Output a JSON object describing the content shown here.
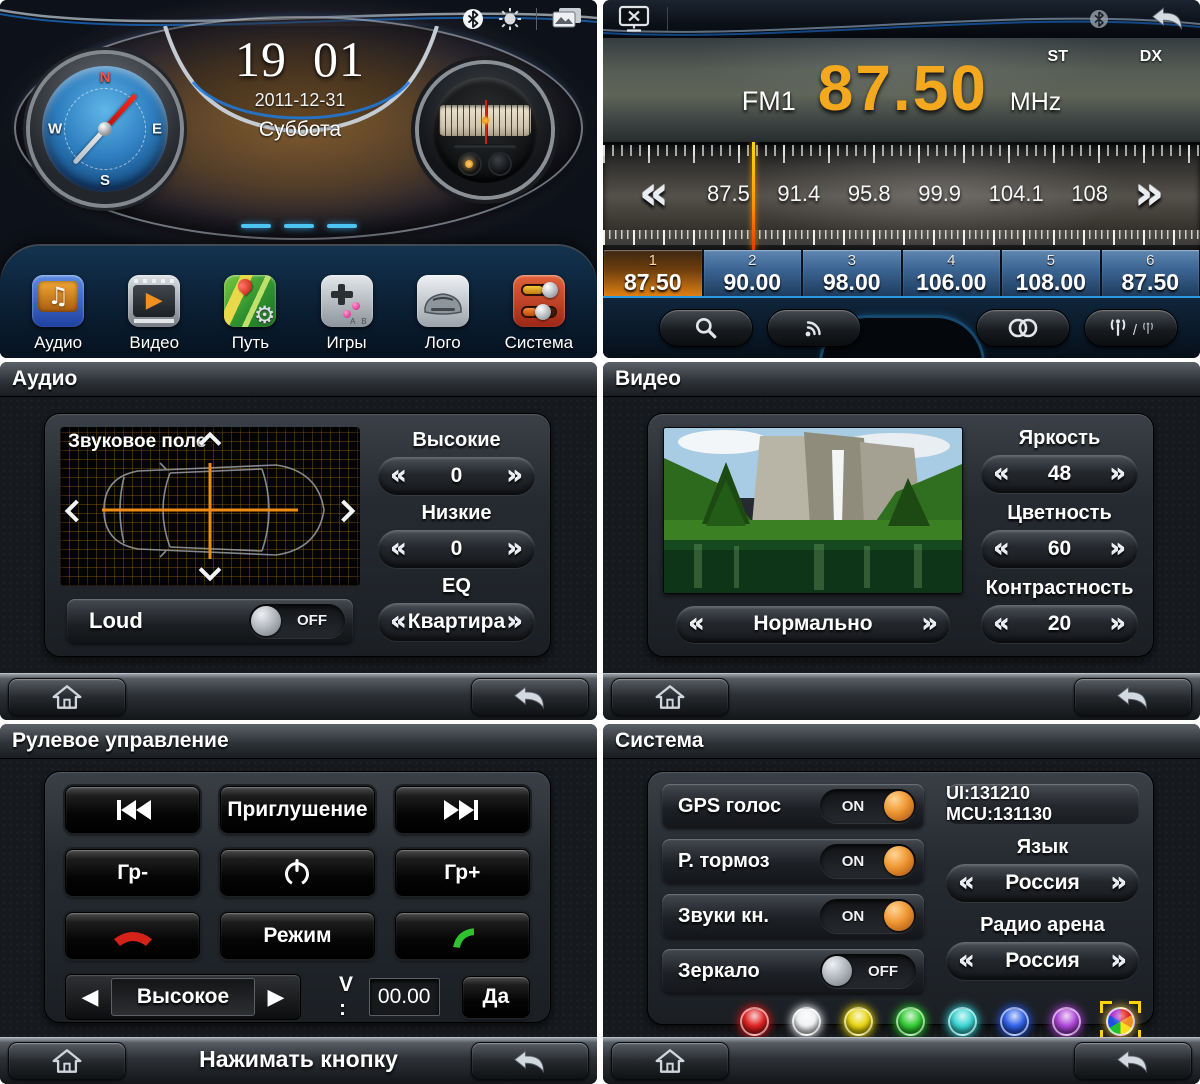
{
  "ui": {
    "spin_left": "«",
    "spin_right": "»",
    "tri_left": "◀",
    "tri_right": "▶",
    "note": "♫",
    "gear": "⚙",
    "play": "▶",
    "game_ab": "A B"
  },
  "home": {
    "time_hours": "19",
    "time_minutes": "01",
    "date": "2011-12-31",
    "weekday": "Суббота",
    "compass": {
      "n": "N",
      "e": "E",
      "s": "S",
      "w": "W"
    },
    "dock": [
      {
        "label": "Аудио"
      },
      {
        "label": "Видео"
      },
      {
        "label": "Путь"
      },
      {
        "label": "Игры"
      },
      {
        "label": "Лого"
      },
      {
        "label": "Система"
      }
    ]
  },
  "radio": {
    "band": "FM1",
    "frequency": "87.50",
    "unit": "MHz",
    "stereo_flag": "ST",
    "distance_flag": "DX",
    "scale_labels": [
      "87.5",
      "91.4",
      "95.8",
      "99.9",
      "104.1",
      "108"
    ],
    "presets": [
      {
        "num": "1",
        "freq": "87.50"
      },
      {
        "num": "2",
        "freq": "90.00"
      },
      {
        "num": "3",
        "freq": "98.00"
      },
      {
        "num": "4",
        "freq": "106.00"
      },
      {
        "num": "5",
        "freq": "108.00"
      },
      {
        "num": "6",
        "freq": "87.50"
      }
    ]
  },
  "audio": {
    "title": "Аудио",
    "sound_field_label": "Звуковое поле",
    "treble_label": "Высокие",
    "treble_value": "0",
    "bass_label": "Низкие",
    "bass_value": "0",
    "eq_label": "EQ",
    "eq_value": "Квартира",
    "loud_label": "Loud",
    "loud_state": "OFF"
  },
  "video": {
    "title": "Видео",
    "brightness_label": "Яркость",
    "brightness_value": "48",
    "saturation_label": "Цветность",
    "saturation_value": "60",
    "contrast_label": "Контрастность",
    "contrast_value": "20",
    "mode_value": "Нормально"
  },
  "steering": {
    "title": "Рулевое управление",
    "mute_label": "Приглушение",
    "vol_down_label": "Гр-",
    "vol_up_label": "Гр+",
    "mode_label": "Режим",
    "level_value": "Высокое",
    "voltage_label": "V :",
    "voltage_value": "00.00",
    "confirm_label": "Да",
    "hint": "Нажимать кнопку"
  },
  "system": {
    "title": "Система",
    "switches": [
      {
        "label": "GPS голос",
        "state": "ON"
      },
      {
        "label": "Р. тормоз",
        "state": "ON"
      },
      {
        "label": "Звуки кн.",
        "state": "ON"
      },
      {
        "label": "Зеркало",
        "state": "OFF"
      }
    ],
    "version": "UI:131210 MCU:131130",
    "language_label": "Язык",
    "language_value": "Россия",
    "radio_area_label": "Радио арена",
    "radio_area_value": "Россия",
    "theme_colors": [
      "#dd1414",
      "#eef0f2",
      "#e6d300",
      "#25c825",
      "#2fd2d2",
      "#2257e8",
      "#a83ad4"
    ]
  }
}
